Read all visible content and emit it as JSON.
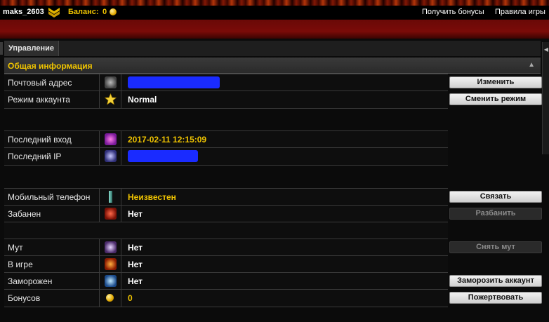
{
  "user": {
    "username": "maks_2603",
    "balance_label": "Баланс:",
    "balance_value": "0"
  },
  "top_links": [
    "Получить бонусы",
    "Правила игры"
  ],
  "panel": {
    "tab_label": "Управление",
    "section_title": "Общая информация"
  },
  "rows": [
    {
      "label": "Почтовый адрес",
      "icon": "mail-icon",
      "value": "",
      "redacted": true,
      "button": "Изменить",
      "button_enabled": true
    },
    {
      "label": "Режим аккаунта",
      "icon": "star-icon",
      "value": "Normal",
      "button": "Сменить режим",
      "button_enabled": true
    },
    {
      "label": "Последний вход",
      "icon": "clock-icon",
      "value": "2017-02-11 12:15:09",
      "value_color": "#f0c400"
    },
    {
      "label": "Последний IP",
      "icon": "network-icon",
      "value": "",
      "redacted": true
    },
    {
      "label": "Мобильный телефон",
      "icon": "phone-icon",
      "value": "Неизвестен",
      "value_color": "#f0c400",
      "button": "Связать",
      "button_enabled": true
    },
    {
      "label": "Забанен",
      "icon": "ban-icon",
      "value": "Нет",
      "button": "Разбанить",
      "button_enabled": false
    },
    {
      "label": "Мут",
      "icon": "mute-icon",
      "value": "Нет",
      "button": "Снять мут",
      "button_enabled": false
    },
    {
      "label": "В игре",
      "icon": "ingame-icon",
      "value": "Нет"
    },
    {
      "label": "Заморожен",
      "icon": "freeze-icon",
      "value": "Нет",
      "button": "Заморозить аккаунт",
      "button_enabled": true
    },
    {
      "label": "Бонусов",
      "icon": "coin-icon",
      "value": "0",
      "value_color": "#f0c400",
      "button": "Пожертвовать",
      "button_enabled": true
    }
  ],
  "colors": {
    "accent_gold": "#f0c400",
    "redaction_blue": "#1a2bff",
    "header_red": "#6a0907"
  }
}
